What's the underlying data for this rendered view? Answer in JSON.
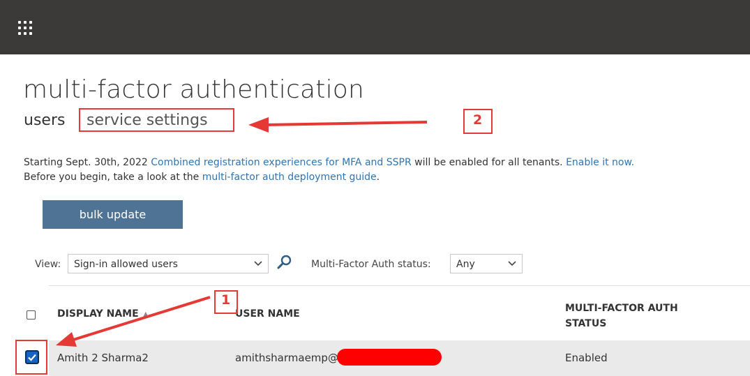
{
  "page": {
    "title": "multi-factor authentication",
    "tabs": {
      "users": "users",
      "service_settings": "service settings"
    }
  },
  "notice": {
    "line1_prefix": "Starting Sept. 30th, 2022 ",
    "line1_link": "Combined registration experiences for MFA and SSPR",
    "line1_mid": " will be enabled for all tenants. ",
    "line1_link2": "Enable it now.",
    "line2_prefix": "Before you begin, take a look at the ",
    "line2_link": "multi-factor auth deployment guide",
    "line2_suffix": "."
  },
  "toolbar": {
    "bulk_update": "bulk update"
  },
  "filters": {
    "view_label": "View:",
    "view_value": "Sign-in allowed users",
    "mfa_label": "Multi-Factor Auth status:",
    "mfa_value": "Any"
  },
  "table": {
    "headers": {
      "display_name": "DISPLAY NAME",
      "user_name": "USER NAME",
      "mfa_status_line1": "MULTI-FACTOR AUTH",
      "mfa_status_line2": "STATUS"
    },
    "sort_indicator": "▲",
    "rows": [
      {
        "display_name": "Amith 2 Sharma2",
        "user_name": "amithsharmaemp@",
        "mfa_status": "Enabled",
        "selected": true
      }
    ]
  },
  "annotations": {
    "num1": "1",
    "num2": "2",
    "color": "#e53935"
  },
  "icons": {
    "app_launcher": "waffle-icon",
    "search": "search-icon",
    "dropdown": "chevron-down-icon"
  },
  "colors": {
    "topbar": "#3b3a39",
    "button": "#4e7394",
    "link": "#2e74b5",
    "selected_checkbox": "#1565c0",
    "row_highlight": "#eaeaea"
  }
}
